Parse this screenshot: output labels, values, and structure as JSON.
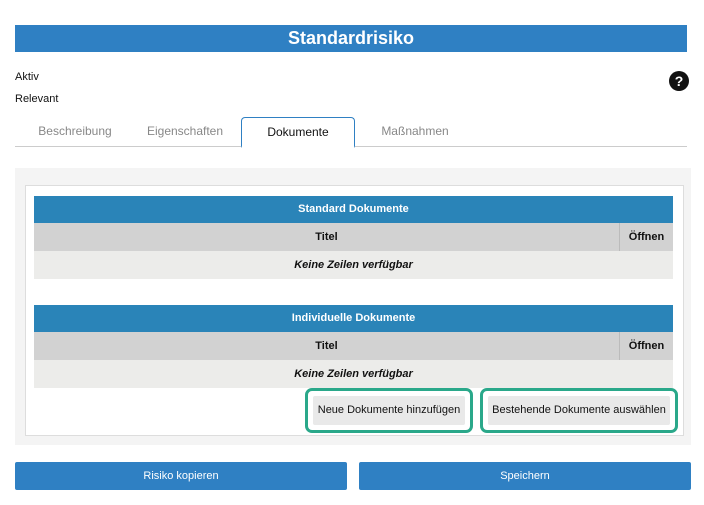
{
  "header": {
    "title": "Standardrisiko"
  },
  "status": {
    "aktiv": "Aktiv",
    "relevant": "Relevant"
  },
  "help": {
    "icon": "question-circle-icon",
    "glyph": "?"
  },
  "tabs": [
    {
      "label": "Beschreibung",
      "active": false
    },
    {
      "label": "Eigenschaften",
      "active": false
    },
    {
      "label": "Dokumente",
      "active": true
    },
    {
      "label": "Maßnahmen",
      "active": false
    }
  ],
  "standard_documents": {
    "title": "Standard Dokumente",
    "columns": {
      "titel": "Titel",
      "offnen": "Öffnen"
    },
    "empty_text": "Keine Zeilen verfügbar"
  },
  "individual_documents": {
    "title": "Individuelle Dokumente",
    "columns": {
      "titel": "Titel",
      "offnen": "Öffnen"
    },
    "empty_text": "Keine Zeilen verfügbar"
  },
  "actions": {
    "add_new": "Neue Dokumente hinzufügen",
    "select_existing": "Bestehende Dokumente auswählen"
  },
  "footer": {
    "copy_risk": "Risiko kopieren",
    "save": "Speichern"
  },
  "colors": {
    "primary": "#2f80c3",
    "table_header": "#2a84b8",
    "highlight": "#2aa88a"
  }
}
